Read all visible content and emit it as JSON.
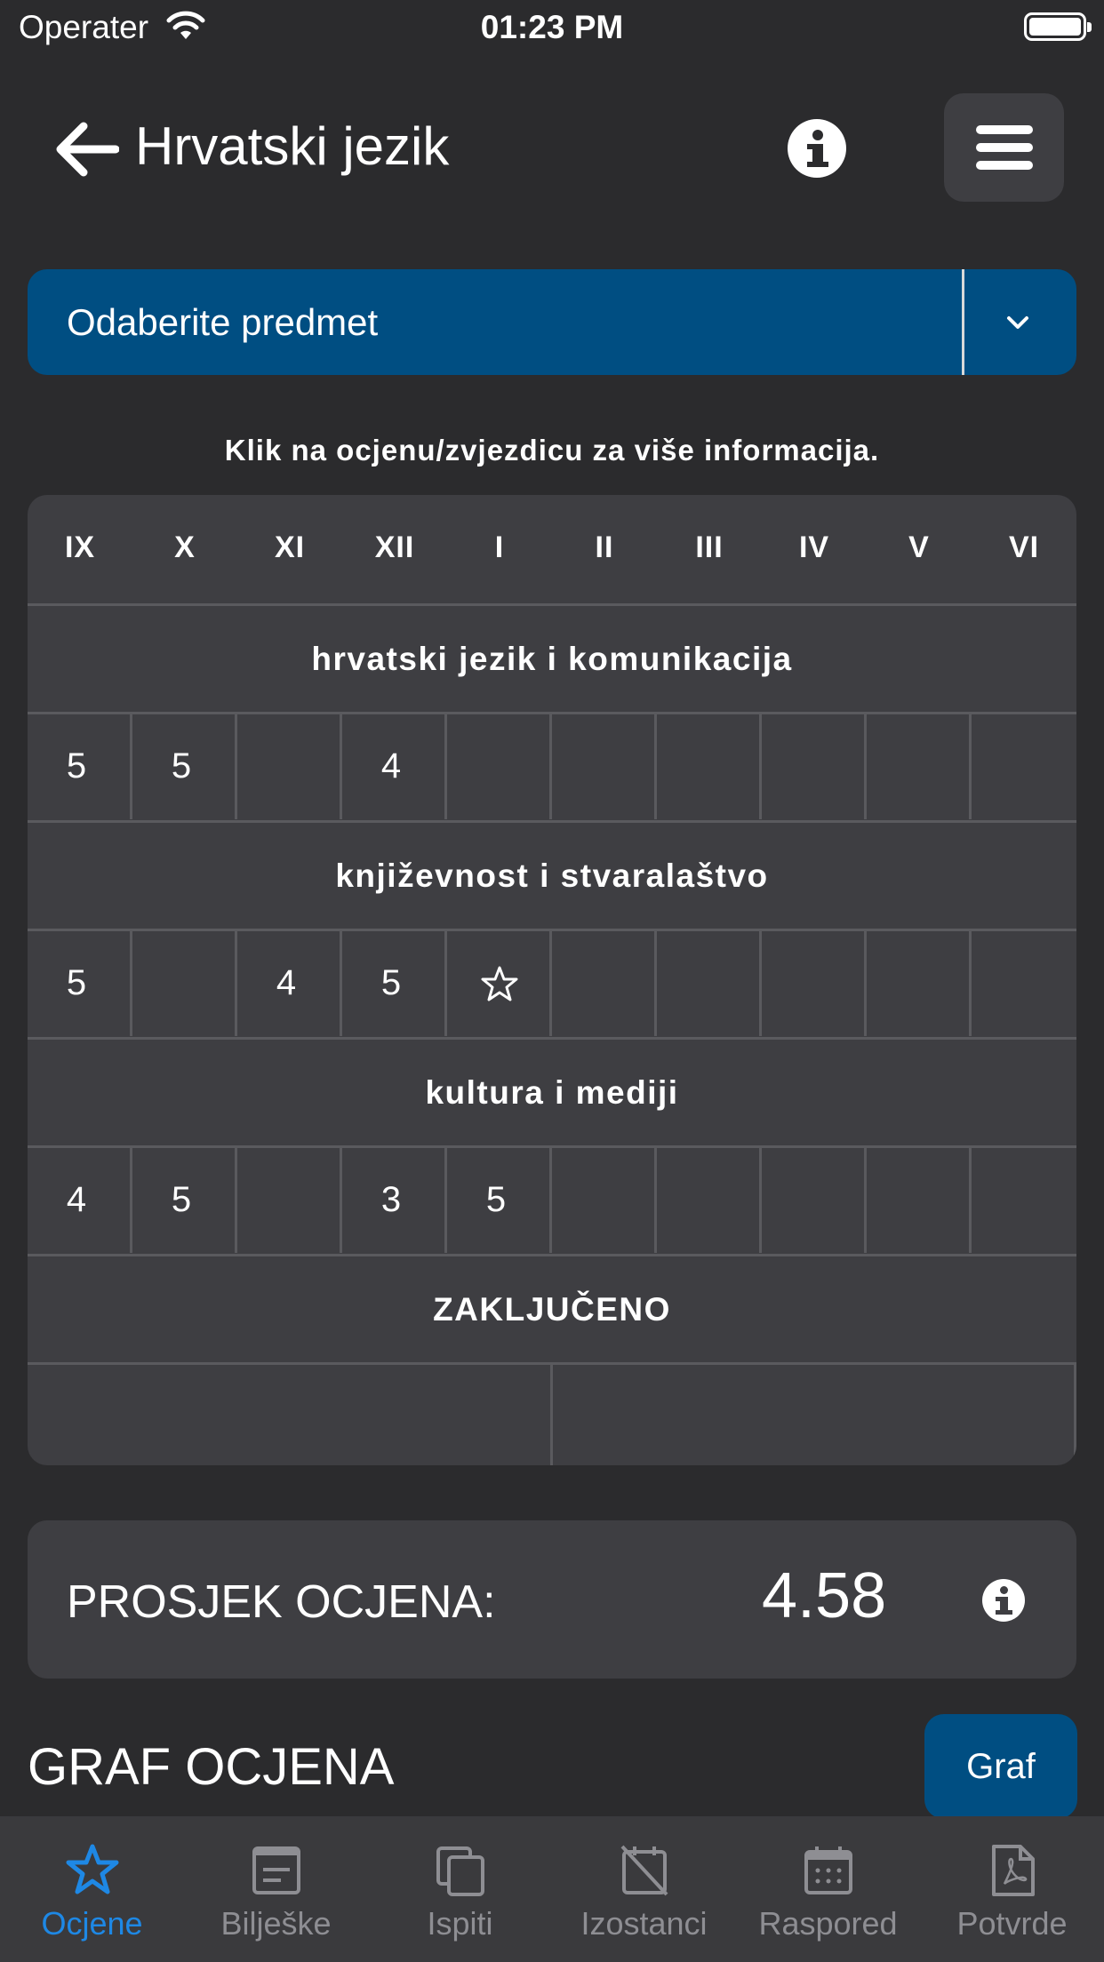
{
  "status_bar": {
    "carrier": "Operater",
    "time": "01:23 PM"
  },
  "header": {
    "title": "Hrvatski jezik"
  },
  "subject_select": {
    "placeholder": "Odaberite predmet"
  },
  "hint": "Klik na ocjenu/zvjezdicu za više informacija.",
  "table": {
    "months": [
      "IX",
      "X",
      "XI",
      "XII",
      "I",
      "II",
      "III",
      "IV",
      "V",
      "VI"
    ],
    "categories": [
      {
        "name": "hrvatski jezik i komunikacija",
        "grades": [
          "5",
          "5",
          "",
          "4",
          "",
          "",
          "",
          "",
          "",
          ""
        ]
      },
      {
        "name": "književnost i stvaralaštvo",
        "grades": [
          "5",
          "",
          "4",
          "5",
          "star",
          "",
          "",
          "",
          "",
          ""
        ]
      },
      {
        "name": "kultura i mediji",
        "grades": [
          "4",
          "5",
          "",
          "3",
          "5",
          "",
          "",
          "",
          "",
          ""
        ]
      }
    ],
    "final_label": "ZAKLJUČENO"
  },
  "average": {
    "label": "PROSJEK OCJENA:",
    "value": "4.58"
  },
  "graph": {
    "title": "GRAF OCJENA",
    "button_label": "Graf"
  },
  "tabs": [
    {
      "label": "Ocjene",
      "icon": "star-icon",
      "active": true
    },
    {
      "label": "Bilješke",
      "icon": "notes-icon",
      "active": false
    },
    {
      "label": "Ispiti",
      "icon": "copy-icon",
      "active": false
    },
    {
      "label": "Izostanci",
      "icon": "calendar-off-icon",
      "active": false
    },
    {
      "label": "Raspored",
      "icon": "calendar-icon",
      "active": false
    },
    {
      "label": "Potvrde",
      "icon": "pdf-icon",
      "active": false
    }
  ],
  "colors": {
    "accent": "#004e82",
    "active_tab": "#1e88e5",
    "background": "#2b2b2d",
    "card": "#3e3e42"
  }
}
